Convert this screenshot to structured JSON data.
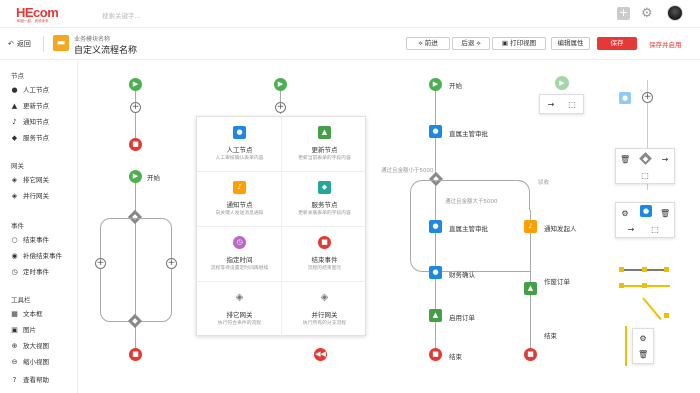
{
  "topbar": {
    "logo": "HEcom",
    "logo_sub": "和极一起，创领未来",
    "search_placeholder": "搜索关键字..."
  },
  "header": {
    "back_label": "返回",
    "module_sub": "业务模块名称",
    "module_title": "自定义流程名称",
    "btn_forward": "前进",
    "btn_back": "后退",
    "btn_print": "打印视图",
    "btn_props": "编辑属性",
    "btn_save": "保存",
    "btn_save_apply": "保存并启用"
  },
  "sidebar": {
    "nodes_title": "节点",
    "nodes": [
      "人工节点",
      "更新节点",
      "通知节点",
      "服务节点"
    ],
    "gateways_title": "网关",
    "gateways": [
      "排它网关",
      "并行网关"
    ],
    "events_title": "事件",
    "events": [
      "结束事件",
      "补偿结束事件",
      "定时事件"
    ],
    "tools_title": "工具栏",
    "tools": [
      "文本框",
      "图片",
      "放大视图",
      "缩小视图",
      "查看帮助"
    ]
  },
  "canvas": {
    "start_label": "开始",
    "approve_label": "直属主管审批",
    "cond_lt": "通过且金额小于5000",
    "cond_gt": "通过且金额大于5000",
    "reject_label": "驳收",
    "finance_label": "财务确认",
    "enable_order": "启用订单",
    "end_label": "结束",
    "notify_label": "通知发起人",
    "void_order": "作废订单",
    "end_label2": "结束"
  },
  "palette": [
    {
      "title": "人工节点",
      "desc": "人工审核确认表单内容"
    },
    {
      "title": "更新节点",
      "desc": "更新当前表单的字段内容"
    },
    {
      "title": "通知节点",
      "desc": "向关键人发送消息通知"
    },
    {
      "title": "服务节点",
      "desc": "更新关联表单的字段内容"
    },
    {
      "title": "指定时间",
      "desc": "流程等待设置定时间再继续"
    },
    {
      "title": "结束事件",
      "desc": "流程的结束图元"
    },
    {
      "title": "排它网关",
      "desc": "执行符合条件的流程"
    },
    {
      "title": "并行网关",
      "desc": "执行所有的分支流程"
    }
  ],
  "colors": {
    "accent": "#e53935",
    "start": "#4caf50",
    "node_blue": "#1e88e5",
    "node_green": "#43a047",
    "node_orange": "#ffa000",
    "timer_purple": "#ba68c8",
    "service_teal": "#26a69a"
  }
}
